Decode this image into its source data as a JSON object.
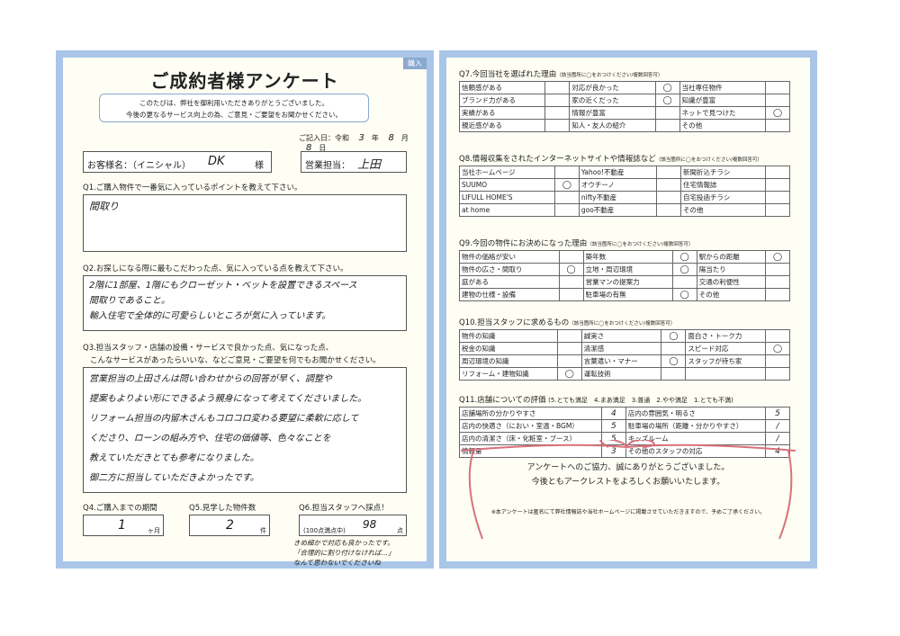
{
  "left": {
    "tag": "購入",
    "title": "ご成約者様アンケート",
    "intro_line1": "このたびは、弊社を御利用いただきありがとうございました。",
    "intro_line2": "今後の更なるサービス向上の為、ご意見・ご要望をお聞かせください。",
    "date_label": "ご記入日：令和",
    "date_year": "3",
    "date_year_unit": "年",
    "date_month": "8",
    "date_month_unit": "月",
    "date_day": "8",
    "date_day_unit": "日",
    "customer_label": "お客様名：（イニシャル）",
    "customer_value": "DK",
    "customer_suffix": "様",
    "staff_label": "営業担当：",
    "staff_value": "上田",
    "q1": "Q1.ご購入物件で一番気に入っているポイントを教えて下さい。",
    "q1_answer": "間取り",
    "q2": "Q2.お探しになる際に最もこだわった点、気に入っている点を教えて下さい。",
    "q2_lines": [
      "2階に1部屋、1階にもクローゼット・ベットを設置できるスペース",
      "間取りであること。",
      "輸入住宅で全体的に可愛らしいところが気に入っています。"
    ],
    "q3": "Q3.担当スタッフ・店舗の設備・サービスで良かった点、気になった点、",
    "q3b": "こんなサービスがあったらいいな、などご意見・ご要望を何でもお聞かせください。",
    "q3_lines": [
      "営業担当の上田さんは問い合わせからの回答が早く、調整や",
      "提案もよりよい形にできるよう親身になって考えてくださいました。",
      "リフォーム担当の内留木さんもコロコロ変わる要望に柔軟に応して",
      "くださり、ローンの組み方や、住宅の価値等、色々なことを",
      "教えていただきとても参考になりました。",
      "御二方に担当していただきよかったです。"
    ],
    "q4": "Q4.ご購入までの期間",
    "q4_value": "1",
    "q4_unit": "ヶ月",
    "q5": "Q5.見学した物件数",
    "q5_value": "2",
    "q5_unit": "件",
    "q6": "Q6.担当スタッフへ採点！",
    "q6_note": "(100点満点中)",
    "q6_value": "98",
    "q6_unit": "点",
    "q6_comment1": "きめ細かで対応も良かったです。",
    "q6_comment2": "「合理的に割り付けなければ…」",
    "q6_comment3": "なんて思わないでくださいね"
  },
  "right": {
    "q7": "Q7.今回当社を選ばれた理由",
    "q7_note": "（該当箇所に◯をおつけください/複数回答可）",
    "q7_rows": [
      [
        "信頼感がある",
        "",
        "対応が良かった",
        "◯",
        "当社専任物件",
        ""
      ],
      [
        "ブランド力がある",
        "",
        "家の近くだった",
        "◯",
        "知識が豊富",
        ""
      ],
      [
        "実績がある",
        "",
        "情報が豊富",
        "",
        "ネットで見つけた",
        "◯"
      ],
      [
        "親近感がある",
        "",
        "知人・友人の紹介",
        "",
        "その他",
        ""
      ]
    ],
    "q8": "Q8.情報収集をされたインターネットサイトや情報誌など",
    "q8_note": "（該当箇所に◯をおつけください/複数回答可）",
    "q8_rows": [
      [
        "当社ホームページ",
        "",
        "Yahoo!不動産",
        "",
        "新聞折込チラシ",
        ""
      ],
      [
        "SUUMO",
        "◯",
        "オウチーノ",
        "",
        "住宅情報誌",
        ""
      ],
      [
        "LIFULL HOME'S",
        "",
        "nifty不動産",
        "",
        "自宅投函チラシ",
        ""
      ],
      [
        "at home",
        "",
        "goo不動産",
        "",
        "その他",
        ""
      ]
    ],
    "q9": "Q9.今回の物件にお決めになった理由",
    "q9_note": "（該当箇所に◯をおつけください/複数回答可）",
    "q9_rows": [
      [
        "物件の価格が安い",
        "",
        "築年数",
        "◯",
        "駅からの距離",
        "◯"
      ],
      [
        "物件の広さ・間取り",
        "◯",
        "立地・周辺環境",
        "◯",
        "陽当たり",
        ""
      ],
      [
        "庭がある",
        "",
        "営業マンの提案力",
        "",
        "交通の利便性",
        ""
      ],
      [
        "建物の仕様・設備",
        "",
        "駐車場の有無",
        "◯",
        "その他",
        ""
      ]
    ],
    "q10": "Q10.担当スタッフに求めるもの",
    "q10_note": "（該当箇所に◯をおつけください/複数回答可）",
    "q10_rows": [
      [
        "物件の知識",
        "",
        "誠実さ",
        "◯",
        "面白さ・トーク力",
        ""
      ],
      [
        "税金の知識",
        "",
        "清潔感",
        "",
        "スピード対応",
        "◯"
      ],
      [
        "周辺環境の知識",
        "",
        "言葉遣い・マナー",
        "◯",
        "スタッフが待ち家",
        ""
      ],
      [
        "リフォーム・建物知識",
        "◯",
        "運転技術",
        "",
        "",
        ""
      ]
    ],
    "q11": "Q11.店舗についての評価",
    "q11_scale": "(5.とても満足　4.まあ満足　3.普通　2.やや満足　1.とても不満)",
    "q11_rows": [
      [
        "店舗場所の分かりやすさ",
        "4",
        "店内の雰囲気・明るさ",
        "5"
      ],
      [
        "店内の快適さ（におい・室温・BGM）",
        "5",
        "駐車場の場所（距離・分かりやすさ）",
        "/"
      ],
      [
        "店内の清潔さ（床・化粧室・ブース）",
        "5",
        "キッズルーム",
        "/"
      ],
      [
        "情報量",
        "3",
        "その他のスタッフの対応",
        "4"
      ]
    ],
    "thanks1": "アンケートへのご協力、誠にありがとうございました。",
    "thanks2": "今後ともアークレストをよろしくお願いいたします。",
    "footnote": "※本アンケートは匿名にて弊社情報誌や当社ホームページに掲載させていただきますので、予めご了承ください。"
  },
  "colors": {
    "frame": "#a9c6e8",
    "paper": "#fffef4",
    "ribbon": "#d9707a"
  }
}
